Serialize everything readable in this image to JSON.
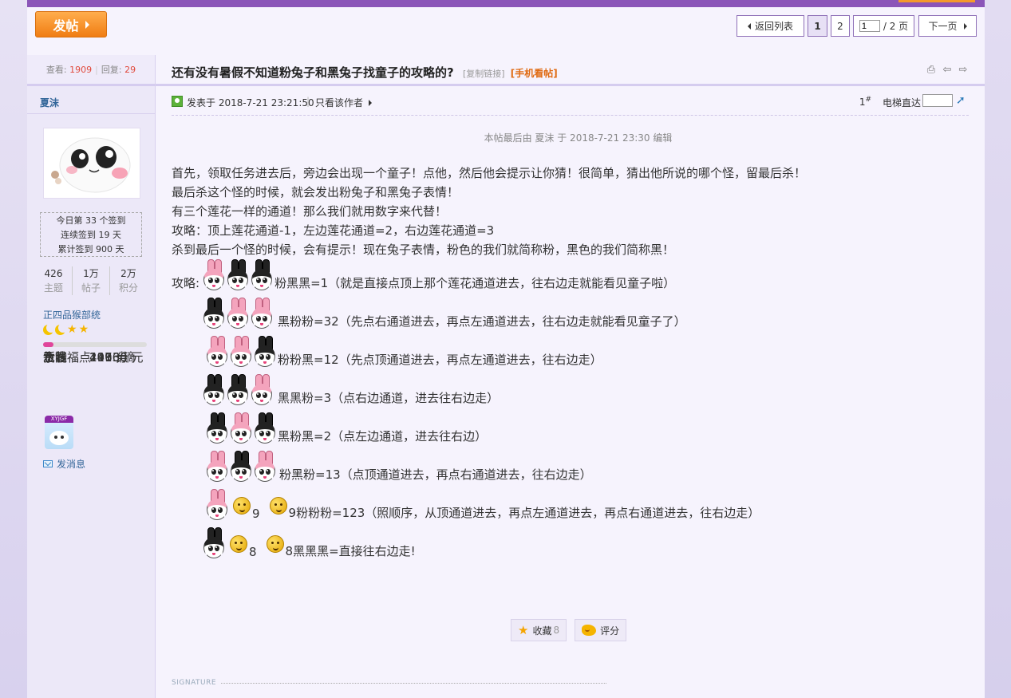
{
  "toolbar": {
    "post_label": "发帖"
  },
  "pagination": {
    "back_label": "返回列表",
    "pages": [
      "1",
      "2"
    ],
    "current_input": "1",
    "total_label": "/ 2 页",
    "next_label": "下一页"
  },
  "sidebar": {
    "views_label": "查看:",
    "views": "1909",
    "replies_label": "回复:",
    "replies": "29",
    "author": "夏沫",
    "checkin": [
      "今日第 33 个签到",
      "连续签到 19 天",
      "累计签到 900 天"
    ],
    "counts": [
      {
        "value": "426",
        "label": "主题"
      },
      {
        "value": "1万",
        "label": "帖子"
      },
      {
        "value": "2万",
        "label": "积分"
      }
    ],
    "group": "正四品猴部统",
    "level_progress": 0.1,
    "attributes": [
      {
        "key": "新春福点",
        "value": "296 点"
      },
      {
        "key": "金钱",
        "value": "10960 元"
      },
      {
        "key": "贡献",
        "value": "447 分"
      },
      {
        "key": "水滴",
        "value": "1113 滴"
      }
    ],
    "medal_tag": "XYJGF",
    "send_message": "发消息"
  },
  "post": {
    "title": "还有没有暑假不知道粉兔子和黑兔子找童子的攻略的?",
    "copy_link": "[复制链接]",
    "mobile_view": "[手机看帖]",
    "posted": "发表于 2018-7-21 23:21:50",
    "only_author": "只看该作者",
    "floor": "1",
    "floor_mark": "#",
    "elevator": "电梯直达",
    "edited": "本帖最后由 夏沫 于 2018-7-21 23:30 编辑",
    "paragraphs": [
      "首先，领取任务进去后，旁边会出现一个童子！点他，然后他会提示让你猜！很简单，猜出他所说的哪个怪，留最后杀！",
      "最后杀这个怪的时候，就会发出粉兔子和黑兔子表情！",
      "有三个莲花一样的通道！那么我们就用数字来代替！",
      "攻略：顶上莲花通道-1，左边莲花通道=2，右边莲花通道=3",
      "杀到最后一个怪的时候，会有提示！现在兔子表情，粉色的我们就简称粉，黑色的我们简称黑！"
    ],
    "guide_label": "攻略:",
    "guide": [
      "粉黑黑=1（就是直接点顶上那个莲花通道进去，往右边走就能看见童子啦）",
      "黑粉粉=32（先点右通道进去，再点左通道进去，往右边走就能看见童子了）",
      "粉粉黑=12（先点顶通道进去，再点左通道进去，往右边走）",
      "黑黑粉=3（点右边通道，进去往右边走）",
      "黑粉黑=2（点左边通道，进去往右边）",
      "粉黑粉=13（点顶通道进去，再点右通道进去，往右边走）",
      "9粉粉粉=123（照顺序，从顶通道进去，再点左通道进去，再点右通道进去，往右边走）",
      "8黑黑黑=直接往右边走!"
    ],
    "guide_prefix_nums": [
      "9",
      "8"
    ],
    "favorite_label": "收藏",
    "favorite_count": "8",
    "rate_label": "评分",
    "signature": "SIGNATURE"
  },
  "colors": {
    "accent": "#8b55b8",
    "orange": "#f07d13",
    "link": "#336699"
  }
}
